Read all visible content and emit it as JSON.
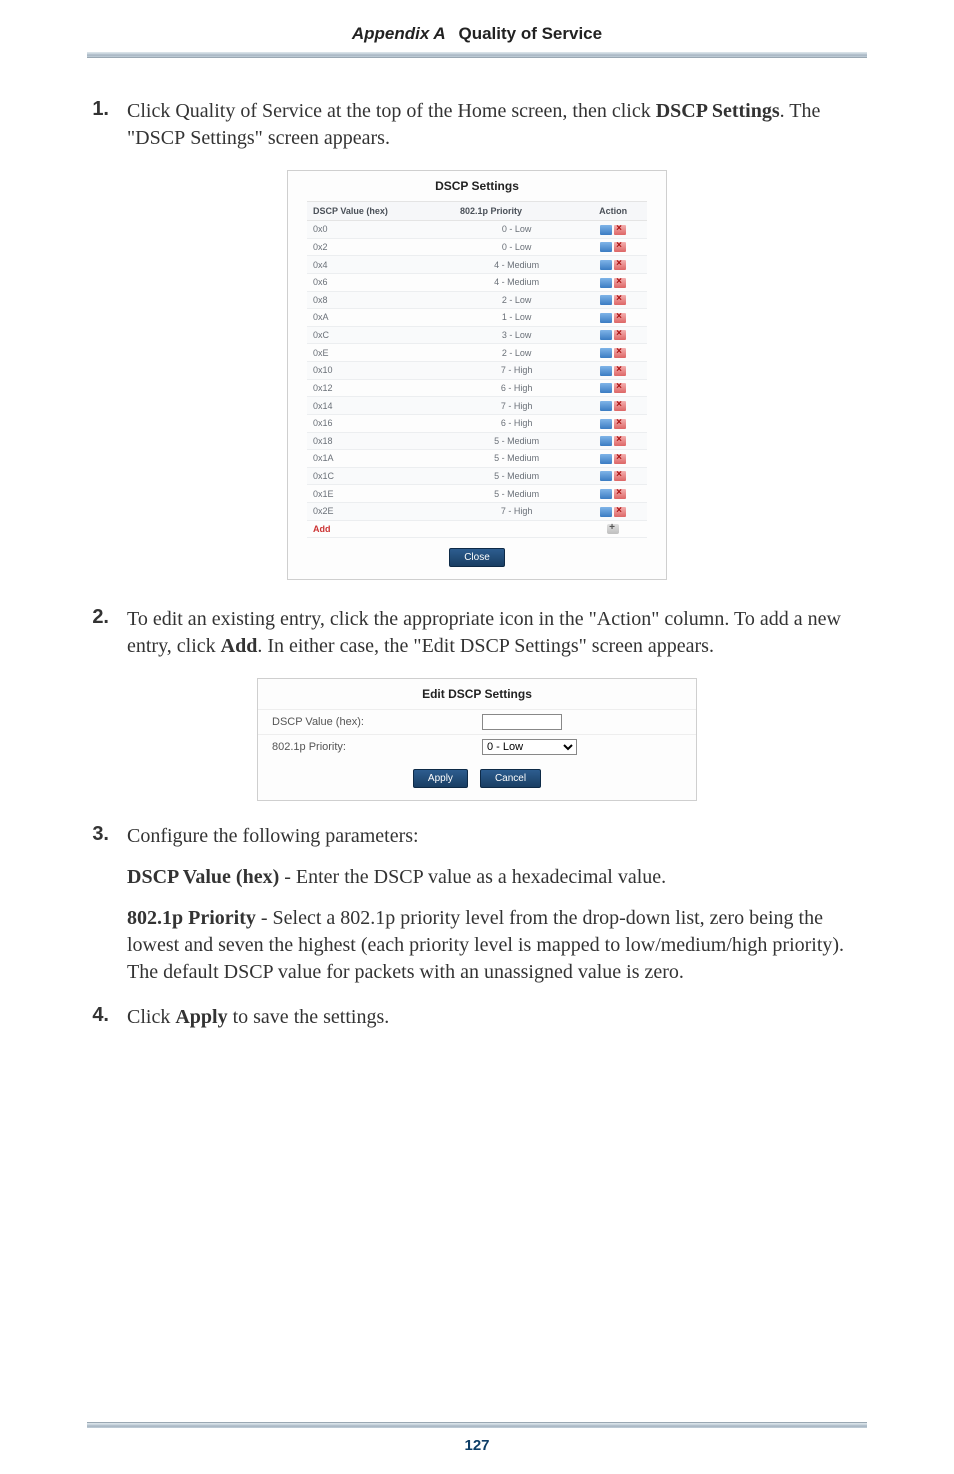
{
  "header": {
    "appendix": "Appendix A",
    "title": "Quality of Service"
  },
  "steps": {
    "s1": {
      "num": "1.",
      "text_a": "Click Quality of Service at the top of the Home screen, then click ",
      "text_b": "DSCP Settings",
      "text_c": ". The \"",
      "text_sc": "DSCP",
      "text_d": " Settings\" screen appears."
    },
    "s2": {
      "num": "2.",
      "text_a": "To edit an existing entry, click the appropriate icon in the \"Action\" column. To add a new entry, click ",
      "text_b": "Add",
      "text_c": ". In either case, the \"Edit DSCP Settings\" screen appears."
    },
    "s3": {
      "num": "3.",
      "text": "Configure the following parameters:"
    },
    "s4": {
      "num": "4.",
      "text_a": "Click ",
      "text_b": "Apply",
      "text_c": " to save the settings."
    }
  },
  "params": {
    "dscp_value": {
      "label": "DSCP Value (hex)",
      "desc_a": " - Enter the ",
      "desc_sc": "DSCP",
      "desc_b": " value as a hexadecimal value."
    },
    "priority": {
      "label": "802.1p Priority",
      "desc_a": " - Select a 802.1p priority level from the drop-down list, zero being the lowest and seven the highest (each priority level is mapped to low/medium/high priority). The default ",
      "desc_sc": "DSCP",
      "desc_b": " value for packets with an unassigned value is zero."
    }
  },
  "dscp_panel": {
    "title": "DSCP Settings",
    "headers": {
      "c1": "DSCP Value (hex)",
      "c2": "802.1p Priority",
      "c3": "Action"
    },
    "rows": [
      {
        "hex": "0x0",
        "pri": "0 - Low"
      },
      {
        "hex": "0x2",
        "pri": "0 - Low"
      },
      {
        "hex": "0x4",
        "pri": "4 - Medium"
      },
      {
        "hex": "0x6",
        "pri": "4 - Medium"
      },
      {
        "hex": "0x8",
        "pri": "2 - Low"
      },
      {
        "hex": "0xA",
        "pri": "1 - Low"
      },
      {
        "hex": "0xC",
        "pri": "3 - Low"
      },
      {
        "hex": "0xE",
        "pri": "2 - Low"
      },
      {
        "hex": "0x10",
        "pri": "7 - High"
      },
      {
        "hex": "0x12",
        "pri": "6 - High"
      },
      {
        "hex": "0x14",
        "pri": "7 - High"
      },
      {
        "hex": "0x16",
        "pri": "6 - High"
      },
      {
        "hex": "0x18",
        "pri": "5 - Medium"
      },
      {
        "hex": "0x1A",
        "pri": "5 - Medium"
      },
      {
        "hex": "0x1C",
        "pri": "5 - Medium"
      },
      {
        "hex": "0x1E",
        "pri": "5 - Medium"
      },
      {
        "hex": "0x2E",
        "pri": "7 - High"
      }
    ],
    "add_label": "Add",
    "close_label": "Close"
  },
  "edit_panel": {
    "title": "Edit DSCP Settings",
    "row1_label": "DSCP Value (hex):",
    "row1_value": "",
    "row2_label": "802.1p Priority:",
    "row2_value": "0 - Low",
    "apply_label": "Apply",
    "cancel_label": "Cancel"
  },
  "page_number": "127"
}
